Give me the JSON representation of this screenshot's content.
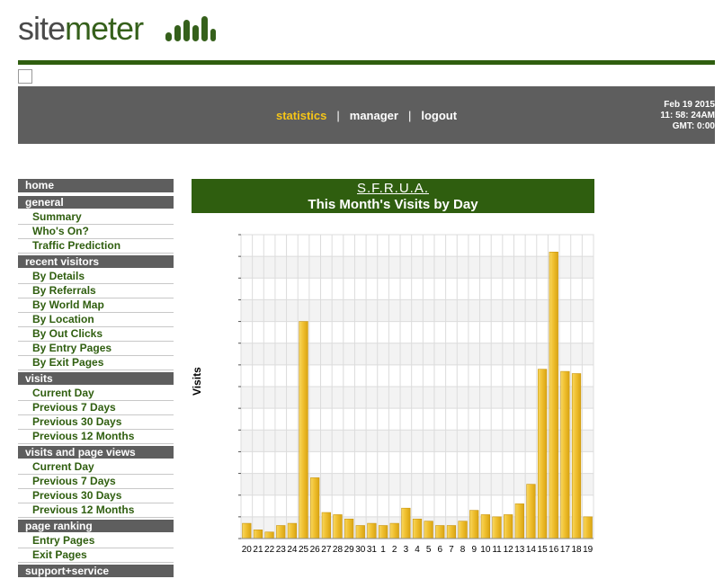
{
  "logo": {
    "part1": "site",
    "part2": "meter"
  },
  "topnav": {
    "items": [
      {
        "label": "statistics",
        "active": true
      },
      {
        "label": "manager",
        "active": false
      },
      {
        "label": "logout",
        "active": false
      }
    ],
    "separator": "|"
  },
  "datetime": {
    "line1": "Feb 19 2015",
    "line2": "11: 58: 24AM",
    "line3": "GMT: 0:00"
  },
  "sidebar": {
    "home": "home",
    "groups": [
      {
        "title": "general",
        "items": [
          "Summary",
          "Who's On?",
          "Traffic Prediction"
        ]
      },
      {
        "title": "recent visitors",
        "items": [
          "By Details",
          "By Referrals",
          "By World Map",
          "By Location",
          "By Out Clicks",
          "By Entry Pages",
          "By Exit Pages"
        ]
      },
      {
        "title": "visits",
        "items": [
          "Current Day",
          "Previous 7 Days",
          "Previous 30 Days",
          "Previous 12 Months"
        ]
      },
      {
        "title": "visits and page views",
        "items": [
          "Current Day",
          "Previous 7 Days",
          "Previous 30 Days",
          "Previous 12 Months"
        ]
      },
      {
        "title": "page ranking",
        "items": [
          "Entry Pages",
          "Exit Pages"
        ]
      },
      {
        "title": "support+service",
        "items": []
      }
    ]
  },
  "colors": {
    "brand_green": "#2f5e0f",
    "bar_bar": "#f0c030",
    "nav_gray": "#5e5e5e",
    "active_nav": "#f5c518"
  },
  "chart_data": {
    "type": "bar",
    "site_name": "S.F.R.U.A.",
    "title": "This Month's Visits by Day",
    "ylabel": "Visits",
    "xlabel": "",
    "categories": [
      "20",
      "21",
      "22",
      "23",
      "24",
      "25",
      "26",
      "27",
      "28",
      "29",
      "30",
      "31",
      "1",
      "2",
      "3",
      "4",
      "5",
      "6",
      "7",
      "8",
      "9",
      "10",
      "11",
      "12",
      "13",
      "14",
      "15",
      "16",
      "17",
      "18",
      "19"
    ],
    "values": [
      7,
      4,
      3,
      6,
      7,
      100,
      28,
      12,
      11,
      9,
      6,
      7,
      6,
      7,
      14,
      9,
      8,
      6,
      6,
      8,
      13,
      11,
      10,
      11,
      16,
      25,
      78,
      132,
      77,
      76,
      10
    ],
    "ylim": [
      0,
      140
    ],
    "grid": true,
    "legend": "none"
  }
}
